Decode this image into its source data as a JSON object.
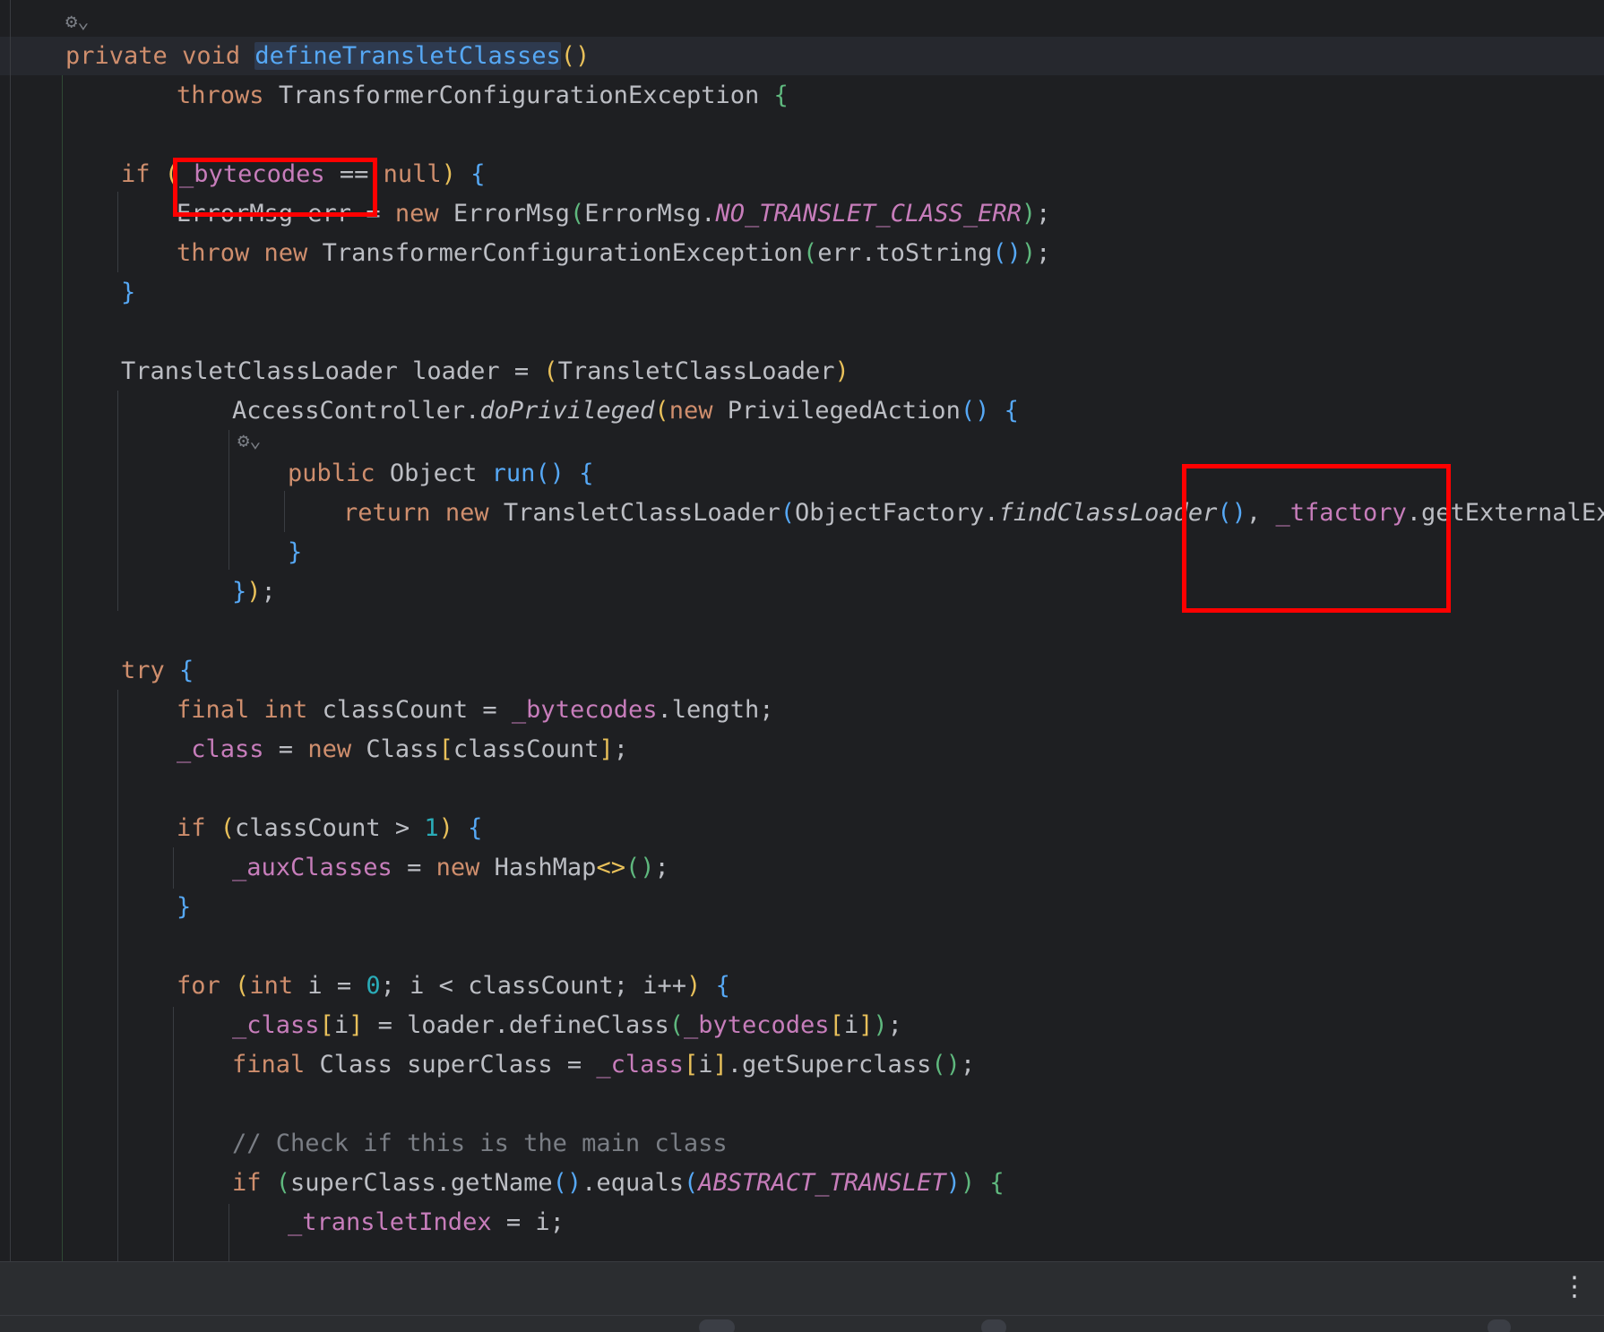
{
  "editor": {
    "lines": {
      "l1": {
        "kw_private": "private",
        "kw_void": "void",
        "method": "defineTransletClasses",
        "parens": "()"
      },
      "l2": {
        "kw_throws": "throws",
        "ex": "TransformerConfigurationException",
        "brace": "{"
      },
      "l3": {
        "kw_if": "if",
        "pre": "(",
        "var": "_bytecodes",
        "op": " == ",
        "nul": "null",
        "close": ")",
        "brace": "{"
      },
      "l4": {
        "type": "ErrorMsg err = ",
        "kw_new": "new",
        "cls": "ErrorMsg",
        "p1": "(",
        "ref": "ErrorMsg.",
        "const": "NO_TRANSLET_CLASS_ERR",
        "p2": ")",
        "end": ";"
      },
      "l5": {
        "kw_throw": "throw",
        "kw_new": "new",
        "cls": "TransformerConfigurationException",
        "p1": "(",
        "arg": "err.toString",
        "p2": "()",
        "p3": ")",
        "end": ";"
      },
      "l6": {
        "brace": "}"
      },
      "l7": {
        "text": "TransletClassLoader loader = ",
        "p1": "(",
        "cast": "TransletClassLoader",
        "p2": ")"
      },
      "l8": {
        "ref": "AccessController.",
        "method": "doPrivileged",
        "p1": "(",
        "kw_new": "new",
        "cls": "PrivilegedAction",
        "p2": "()",
        "brace": "{"
      },
      "l9": {
        "kw_public": "public",
        "type": "Object",
        "method": "run",
        "p": "()",
        "brace": "{"
      },
      "l10": {
        "kw_return": "return",
        "kw_new": "new",
        "cls": "TransletClassLoader",
        "p1": "(",
        "ref": "ObjectFactory.",
        "method": "findClassLoader",
        "p2": "()",
        "sep": ", ",
        "field": "_tfactory",
        "rest": ".getExternalExten"
      },
      "l11": {
        "brace": "}"
      },
      "l12": {
        "brace": "}",
        "p": ")",
        "end": ";"
      },
      "l13": {
        "kw_try": "try",
        "brace": "{"
      },
      "l14": {
        "kw_final": "final",
        "kw_int": "int",
        "text": "classCount = ",
        "field": "_bytecodes",
        "rest": ".length;"
      },
      "l15": {
        "field": "_class",
        "eq": " = ",
        "kw_new": "new",
        "cls": "Class",
        "b1": "[",
        "arg": "classCount",
        "b2": "]",
        "end": ";"
      },
      "l16": {
        "kw_if": "if",
        "p1": "(",
        "text": "classCount > ",
        "num": "1",
        "p2": ")",
        "brace": "{"
      },
      "l17": {
        "field": "_auxClasses",
        "eq": " = ",
        "kw_new": "new",
        "cls": "HashMap",
        "diamond": "<>",
        "p": "()",
        "end": ";"
      },
      "l18": {
        "brace": "}"
      },
      "l19": {
        "kw_for": "for",
        "p1": "(",
        "kw_int": "int",
        "t1": "i = ",
        "num": "0",
        "t2": "; i < classCount; i++",
        "p2": ")",
        "brace": "{"
      },
      "l20": {
        "field": "_class",
        "b1": "[",
        "i": "i",
        "b2": "]",
        "eq": " = loader.defineClass",
        "p1": "(",
        "field2": "_bytecodes",
        "b3": "[",
        "i2": "i",
        "b4": "]",
        "p2": ")",
        "end": ";"
      },
      "l21": {
        "kw_final": "final",
        "text": "Class superClass = ",
        "field": "_class",
        "b1": "[",
        "i": "i",
        "b2": "]",
        "rest": ".getSuperclass",
        "p": "()",
        "end": ";"
      },
      "l22": {
        "comment": "// Check if this is the main class"
      },
      "l23": {
        "kw_if": "if",
        "p1": "(",
        "text": "superClass.getName",
        "p2": "()",
        "eq": ".equals",
        "p3": "(",
        "const": "ABSTRACT_TRANSLET",
        "p4": ")",
        "p5": ")",
        "brace": "{"
      },
      "l24": {
        "field": "_transletIndex",
        "rest": " = i;"
      }
    }
  },
  "annotations": {
    "color": "#ff0000"
  },
  "statusbar": {
    "more_icon": "⋮"
  }
}
